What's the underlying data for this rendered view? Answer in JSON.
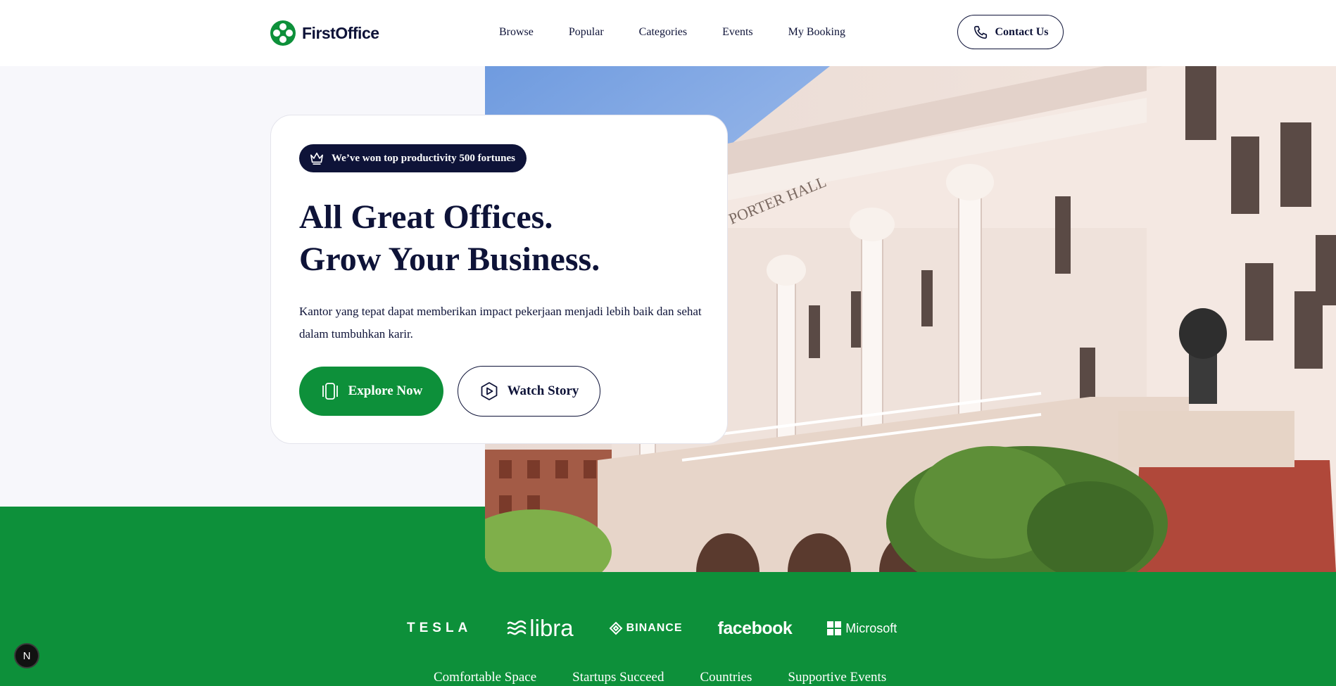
{
  "header": {
    "brand": "FirstOffice",
    "nav": [
      "Browse",
      "Popular",
      "Categories",
      "Events",
      "My Booking"
    ],
    "contact_label": "Contact Us"
  },
  "hero": {
    "badge": "We’ve won top productivity 500 fortunes",
    "headline_line1": "All Great Offices.",
    "headline_line2": "Grow Your Business.",
    "description": "Kantor yang tepat dapat memberikan impact pekerjaan menjadi lebih baik dan sehat dalam tumbuhkan karir.",
    "explore_label": "Explore Now",
    "watch_label": "Watch Story"
  },
  "photo": {
    "sign": "PORTER HALL"
  },
  "brands": {
    "tesla": "TESLA",
    "libra": "libra",
    "binance": "BINANCE",
    "facebook": "facebook",
    "microsoft": "Microsoft"
  },
  "stats": [
    "Comfortable Space",
    "Startups Succeed",
    "Countries",
    "Supportive Events"
  ],
  "dev_badge": "N",
  "colors": {
    "primary_green": "#0D903A",
    "navy": "#0E1338",
    "background": "#F7F7FB",
    "white": "#FFFFFF"
  },
  "icons": {
    "logo": "four-dot-logo-icon",
    "contact": "phone-icon",
    "badge": "crown-icon",
    "explore": "rectangle-stack-icon",
    "watch": "play-hexagon-icon",
    "microsoft": "windows-grid-icon"
  }
}
